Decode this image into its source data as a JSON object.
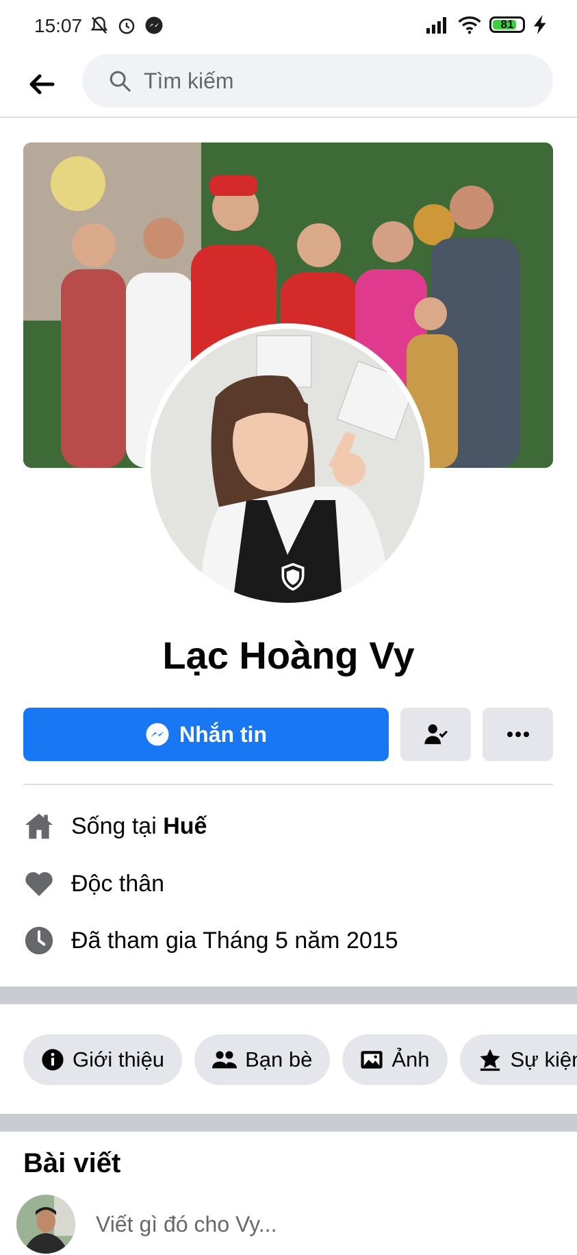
{
  "status_bar": {
    "time": "15:07",
    "battery": "81",
    "battery_level": 0.81
  },
  "header": {
    "search_placeholder": "Tìm kiếm"
  },
  "profile": {
    "name": "Lạc Hoàng Vy"
  },
  "actions": {
    "message_label": "Nhắn tin"
  },
  "info": {
    "lives_prefix": "Sống tại ",
    "lives_city": "Huế",
    "relationship": "Độc thân",
    "joined": "Đã tham gia Tháng 5 năm 2015"
  },
  "tabs": [
    {
      "label": "Giới thiệu",
      "icon": "info-icon"
    },
    {
      "label": "Bạn bè",
      "icon": "friends-icon"
    },
    {
      "label": "Ảnh",
      "icon": "photos-icon"
    },
    {
      "label": "Sự kiện",
      "icon": "star-icon"
    }
  ],
  "posts": {
    "title": "Bài viết",
    "composer_placeholder": "Viết gì đó cho Vy..."
  },
  "colors": {
    "primary": "#1877f2",
    "chip_bg": "#e4e6eb",
    "band": "#c9ccd1",
    "icon_gray": "#65676b"
  }
}
